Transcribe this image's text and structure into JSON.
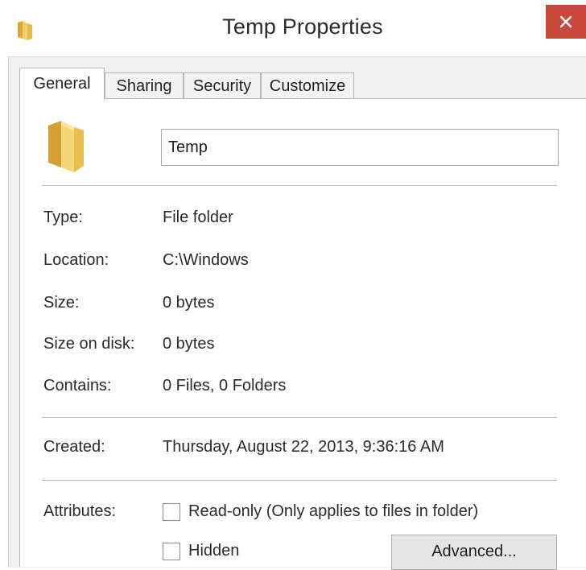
{
  "window": {
    "title": "Temp Properties",
    "close_icon": "close-icon",
    "accent_close": "#c9483c"
  },
  "tabs": [
    {
      "label": "General",
      "active": true
    },
    {
      "label": "Sharing",
      "active": false
    },
    {
      "label": "Security",
      "active": false
    },
    {
      "label": "Customize",
      "active": false
    }
  ],
  "general": {
    "name_value": "Temp",
    "props": {
      "type_label": "Type:",
      "type_value": "File folder",
      "location_label": "Location:",
      "location_value": "C:\\Windows",
      "size_label": "Size:",
      "size_value": "0 bytes",
      "size_on_disk_label": "Size on disk:",
      "size_on_disk_value": "0 bytes",
      "contains_label": "Contains:",
      "contains_value": "0 Files, 0 Folders",
      "created_label": "Created:",
      "created_value": "Thursday, August 22, 2013, 9:36:16 AM"
    },
    "attributes": {
      "label": "Attributes:",
      "readonly_label": "Read-only (Only applies to files in folder)",
      "readonly_checked": false,
      "hidden_label": "Hidden",
      "hidden_checked": false,
      "advanced_button": "Advanced..."
    }
  }
}
